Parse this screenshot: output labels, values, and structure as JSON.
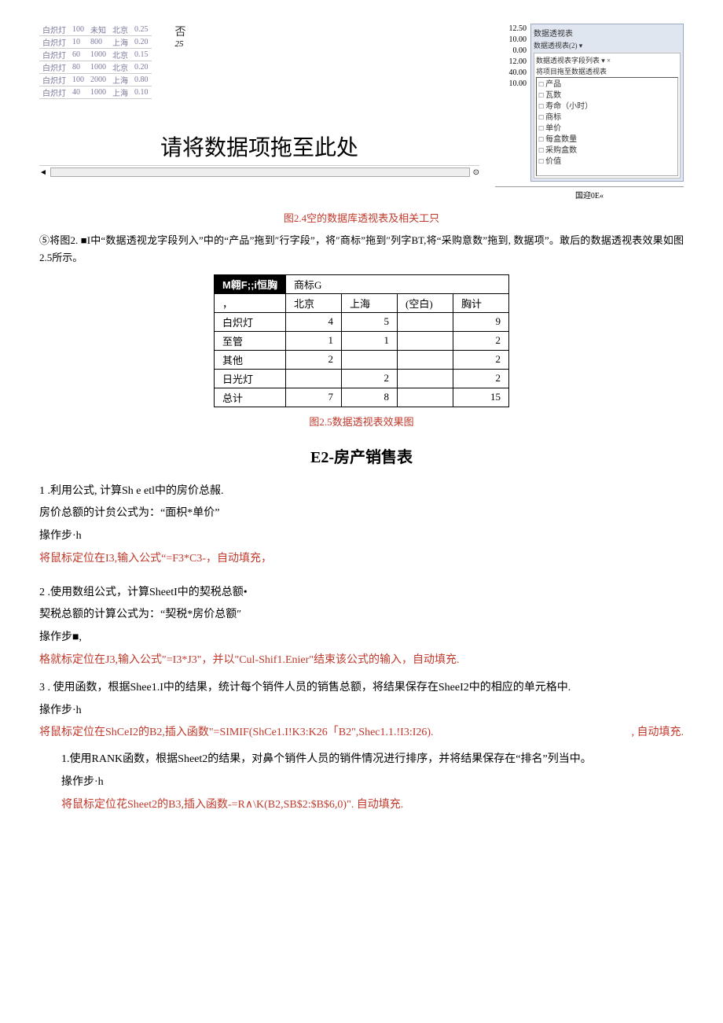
{
  "topTable": {
    "rows": [
      {
        "c0": "白炽灯",
        "c1": "100",
        "c2": "未知",
        "c3": "北京",
        "c4": "0.25"
      },
      {
        "c0": "白炽灯",
        "c1": "10",
        "c2": "800",
        "c3": "上海",
        "c4": "0.20"
      },
      {
        "c0": "白炽灯",
        "c1": "60",
        "c2": "1000",
        "c3": "北京",
        "c4": "0.15"
      },
      {
        "c0": "白炽灯",
        "c1": "80",
        "c2": "1000",
        "c3": "北京",
        "c4": "0.20"
      },
      {
        "c0": "白炽灯",
        "c1": "100",
        "c2": "2000",
        "c3": "上海",
        "c4": "0.80"
      },
      {
        "c0": "白炽灯",
        "c1": "40",
        "c2": "1000",
        "c3": "上海",
        "c4": "0.10"
      }
    ]
  },
  "annot": {
    "char": "否",
    "sub": "25"
  },
  "rightNumbers": [
    "12.50",
    "10.00",
    "0.00",
    "12.00",
    "40.00",
    "10.00"
  ],
  "panel": {
    "title": "数据透视表",
    "sub": "数据透视表(2) ▾",
    "fieldHdr": "数据透视表字段列表 ▾ ×",
    "fieldSub": "将项目拖至数据透视表",
    "items": [
      "产品",
      "瓦数",
      "寿命（小时）",
      "商标",
      "单价",
      "每盒数量",
      "采购盒数",
      "价值"
    ]
  },
  "bottomLabel": "国迎0E«",
  "caption24": "图2.4空的数据库透视表及相关工只",
  "step5": "⑤将图2. ■I中“数据透视龙字段列入”中的“产品”拖到″行字段”，将″商标”拖到″列字BT,将“采购意数”拖到, 数据项”。敢后的数据透视表效果如图2.5所示。",
  "pivot": {
    "corner": "M翱F;;i恒胸",
    "colHeader": "商标G",
    "cols": [
      "北京",
      "上海",
      "(空白)",
      "胸计"
    ],
    "rows": [
      {
        "label": "白炽灯",
        "vals": [
          "4",
          "5",
          "",
          "9"
        ]
      },
      {
        "label": "至管",
        "vals": [
          "1",
          "1",
          "",
          "2"
        ]
      },
      {
        "label": "其他",
        "vals": [
          "2",
          "",
          "",
          "2"
        ]
      },
      {
        "label": "日光灯",
        "vals": [
          "",
          "2",
          "",
          "2"
        ]
      }
    ],
    "totalLabel": "总计",
    "totals": [
      "7",
      "8",
      "",
      "15"
    ]
  },
  "caption25": "图2.5数据透视表效果图",
  "h2": "E2-房产销售表",
  "q1": {
    "a": "1 .利用公式, 计算Sh e etl中的房价总赧.",
    "b": "房价总额的计贠公式为：“面枳*单价”",
    "c": "掾作步·h",
    "d": "将鼠标定位在I3,输入公式“=F3*C3-，自动填充，"
  },
  "q2": {
    "a": "2 .使用数组公式，计算SheetI中的契税总额•",
    "b": "契税总额的计算公式为：“契税*房价总额″",
    "c": "掾作步■,",
    "d": "格就标定位在J3,输入公式″=I3*J3\"，并以\"Cul-Shif1.Enier\"结束该公式的输入，自动填充."
  },
  "q3": {
    "a": "3 . 使用函数，根据Shee1.I中的结果，统计每个销件人员的销售总额，将结果保存在SheeI2中的相应的单元格中.",
    "b": "掾作步·h",
    "c": "将鼠标定位在ShCeI2的B2,插入函数\"=SIMIF(ShCe1.I!K3:K26「B2\",Shec1.1.!I3:I26).",
    "d": ", 自动填充."
  },
  "q4": {
    "a": "1.使用RANK函数，根据Sheet2的结果，对鼻个销件人员的销件情况进行排序，并将结果保存在“排名”列当中。",
    "b": "掾作步·h",
    "c": "将鼠标定位花Sheet2的B3,插入函数-=R∧\\K(B2,SB$2:$B$6,0)\". 自动填充."
  }
}
